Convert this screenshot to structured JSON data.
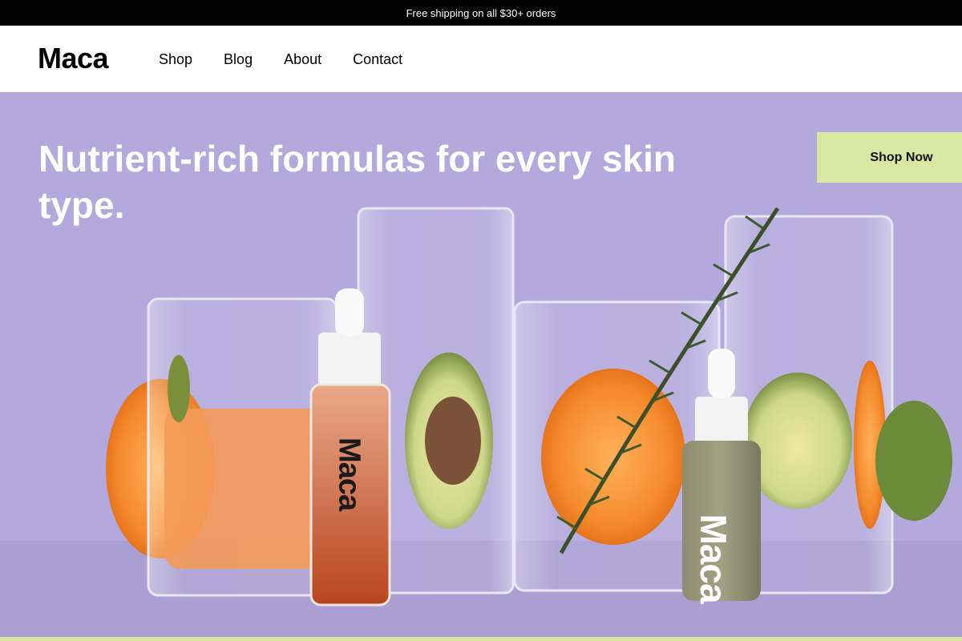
{
  "announcement": {
    "text": "Free shipping on all $30+ orders"
  },
  "brand": {
    "logo_text": "Maca"
  },
  "nav": {
    "items": [
      {
        "label": "Shop"
      },
      {
        "label": "Blog"
      },
      {
        "label": "About"
      },
      {
        "label": "Contact"
      }
    ]
  },
  "hero": {
    "headline": "Nutrient-rich formulas for every skin type.",
    "cta_label": "Shop Now",
    "bottle_label": "Maca"
  },
  "colors": {
    "hero_bg": "#b3a9dc",
    "cta_bg": "#d7e8a2",
    "announcement_bg": "#000000"
  }
}
